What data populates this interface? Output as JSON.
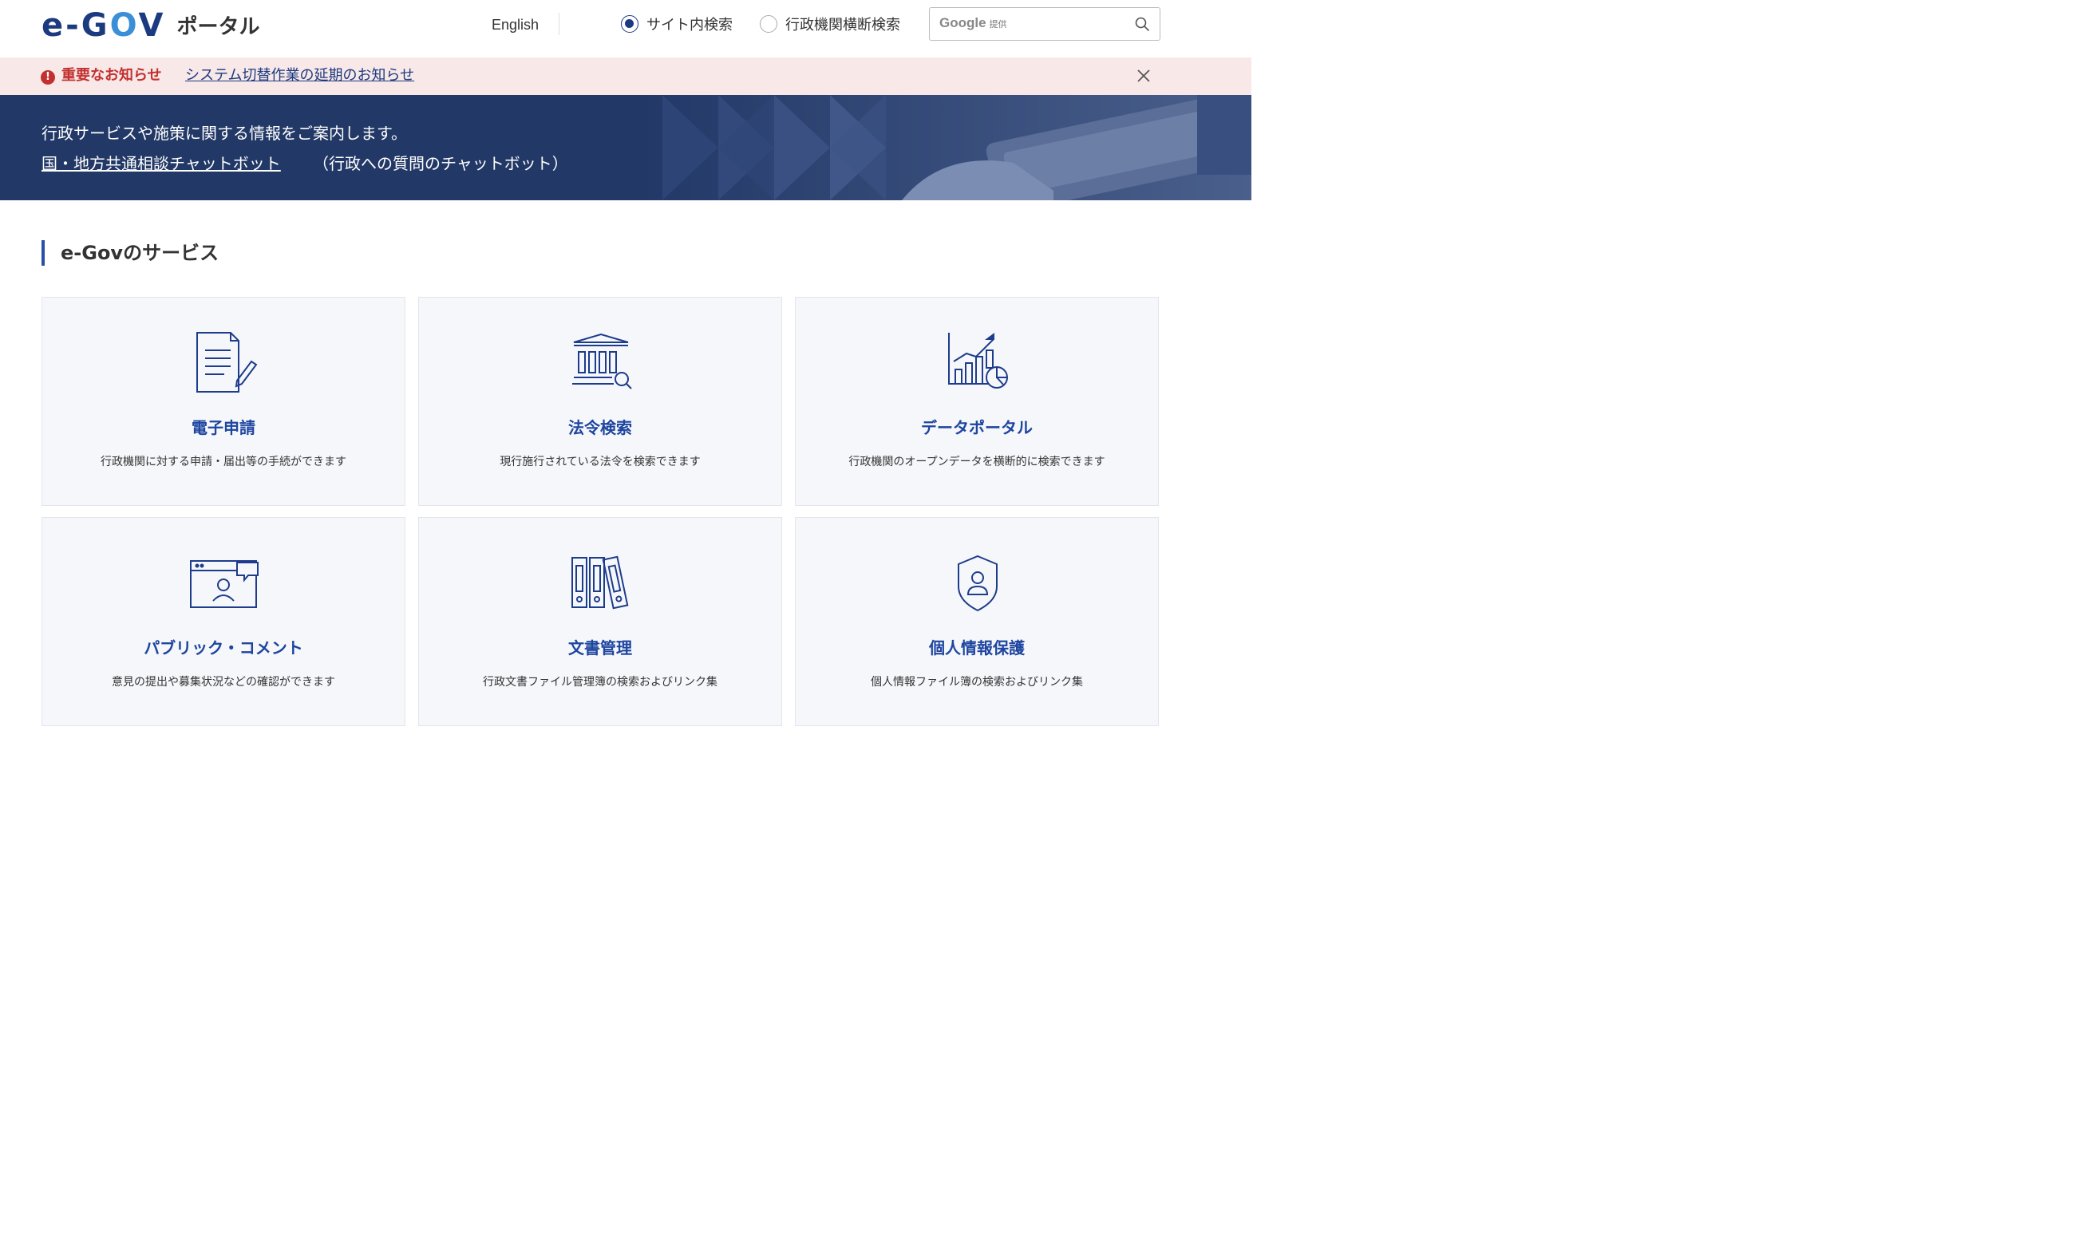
{
  "header": {
    "logo_text_a": "e-G",
    "logo_text_o": "O",
    "logo_text_b": "V",
    "logo_sub": "ポータル",
    "english_link": "English",
    "search_mode": [
      {
        "label": "サイト内検索",
        "selected": true
      },
      {
        "label": "行政機関横断検索",
        "selected": false
      }
    ],
    "search": {
      "brand": "Google",
      "brand_suffix": "提供",
      "placeholder": ""
    }
  },
  "notice": {
    "label": "重要なお知らせ",
    "link": "システム切替作業の延期のお知らせ",
    "icon": "!"
  },
  "hero": {
    "line1": "行政サービスや施策に関する情報をご案内します。",
    "chatbot_link": "国・地方共通相談チャットボット",
    "chatbot_note": "（行政への質問のチャットボット）"
  },
  "services": {
    "title": "e-Govのサービス",
    "items": [
      {
        "title": "電子申請",
        "desc": "行政機関に対する申請・届出等の手続ができます",
        "icon": "document-pen-icon"
      },
      {
        "title": "法令検索",
        "desc": "現行施行されている法令を検索できます",
        "icon": "building-search-icon"
      },
      {
        "title": "データポータル",
        "desc": "行政機関のオープンデータを横断的に検索できます",
        "icon": "chart-icon"
      },
      {
        "title": "パブリック・コメント",
        "desc": "意見の提出や募集状況などの確認ができます",
        "icon": "browser-comment-icon"
      },
      {
        "title": "文書管理",
        "desc": "行政文書ファイル管理簿の検索およびリンク集",
        "icon": "binders-icon"
      },
      {
        "title": "個人情報保護",
        "desc": "個人情報ファイル簿の検索およびリンク集",
        "icon": "shield-person-icon"
      }
    ]
  },
  "colors": {
    "brand_navy": "#1b3a80",
    "brand_blue": "#3a8fd6",
    "hero_bg": "#223866",
    "notice_bg": "#f8e8e7",
    "notice_red": "#c23030",
    "card_title": "#1e45a0"
  }
}
